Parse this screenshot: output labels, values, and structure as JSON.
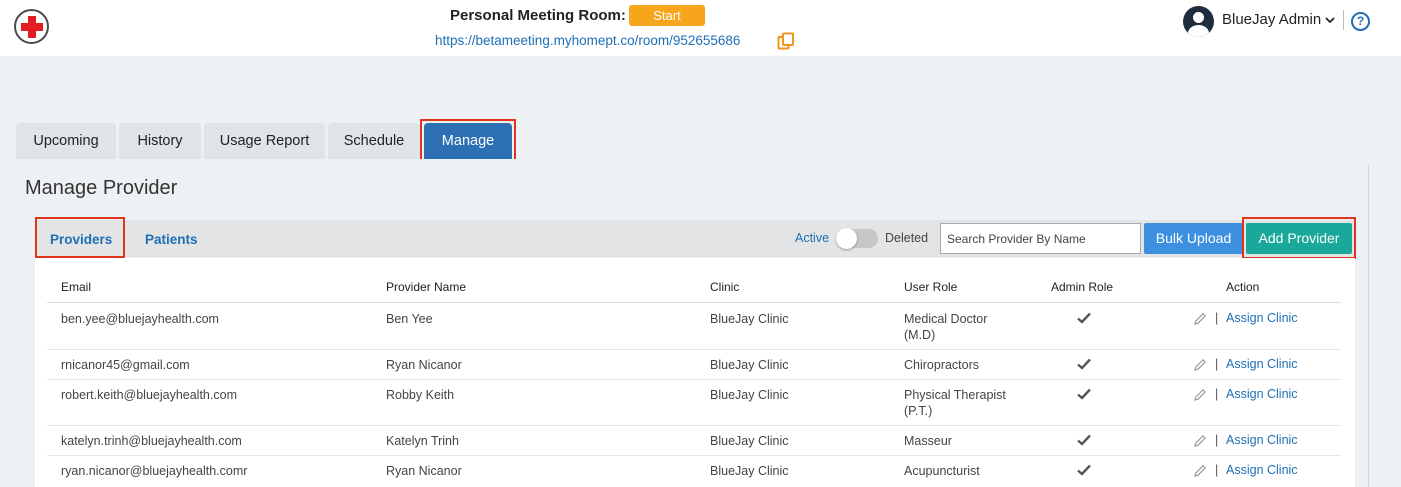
{
  "header": {
    "meeting_label": "Personal Meeting Room:",
    "start_label": "Start",
    "room_url": "https://betameeting.myhomept.co/room/952655686",
    "user_name": "BlueJay Admin",
    "help_glyph": "?",
    "icons": [
      "red-cross-logo",
      "copy-icon",
      "user-avatar",
      "chevron-down-icon",
      "help-icon"
    ]
  },
  "tabs": [
    {
      "label": "Upcoming"
    },
    {
      "label": "History"
    },
    {
      "label": "Usage Report"
    },
    {
      "label": "Schedule"
    },
    {
      "label": "Manage",
      "active": true
    }
  ],
  "page_title": "Manage Provider",
  "subtabs": [
    {
      "label": "Providers",
      "active": true
    },
    {
      "label": "Patients"
    }
  ],
  "toggle": {
    "active_label": "Active",
    "deleted_label": "Deleted",
    "state": "active"
  },
  "search": {
    "placeholder": "Search Provider By Name"
  },
  "buttons": {
    "bulk_upload": "Bulk Upload",
    "add_provider": "Add Provider"
  },
  "table": {
    "columns": [
      "Email",
      "Provider Name",
      "Clinic",
      "User Role",
      "Admin Role",
      "Action"
    ],
    "rows": [
      {
        "email": "ben.yee@bluejayhealth.com",
        "name": "Ben Yee",
        "clinic": "BlueJay Clinic",
        "role_line1": "Medical Doctor",
        "role_line2": "(M.D)",
        "admin": true,
        "action": "Assign Clinic"
      },
      {
        "email": "rnicanor45@gmail.com",
        "name": "Ryan Nicanor",
        "clinic": "BlueJay Clinic",
        "role_line1": "Chiropractors",
        "role_line2": "",
        "admin": true,
        "action": "Assign Clinic"
      },
      {
        "email": "robert.keith@bluejayhealth.com",
        "name": "Robby Keith",
        "clinic": "BlueJay Clinic",
        "role_line1": "Physical Therapist",
        "role_line2": "(P.T.)",
        "admin": true,
        "action": "Assign Clinic"
      },
      {
        "email": "katelyn.trinh@bluejayhealth.com",
        "name": "Katelyn Trinh",
        "clinic": "BlueJay Clinic",
        "role_line1": "Masseur",
        "role_line2": "",
        "admin": true,
        "action": "Assign Clinic"
      },
      {
        "email": "ryan.nicanor@bluejayhealth.comr",
        "name": "Ryan Nicanor",
        "clinic": "BlueJay Clinic",
        "role_line1": "Acupuncturist",
        "role_line2": "",
        "admin": true,
        "action": "Assign Clinic"
      }
    ],
    "separator": "|"
  },
  "colors": {
    "brand_blue": "#2c6fb2",
    "link_blue": "#1f6fb5",
    "start_orange": "#f7a51c",
    "add_teal": "#1aa89a",
    "bulk_blue": "#3d8fe0",
    "highlight_red": "#e0341e"
  }
}
